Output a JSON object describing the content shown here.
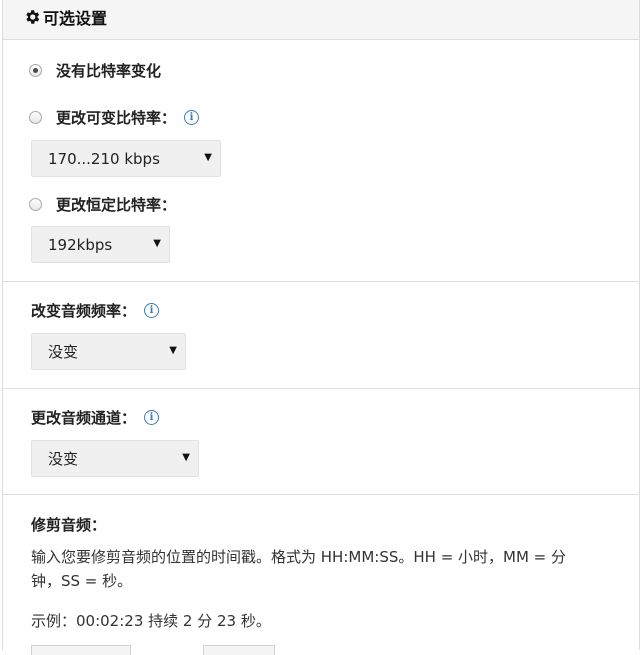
{
  "header": {
    "title": "可选设置",
    "icon": "gear-icon"
  },
  "bitrate": {
    "options": [
      {
        "label": "没有比特率变化",
        "checked": true
      },
      {
        "label": "更改可变比特率：",
        "checked": false
      },
      {
        "label": "更改恒定比特率：",
        "checked": false
      }
    ],
    "variable_select": "170...210 kbps",
    "constant_select": "192kbps"
  },
  "sample_rate": {
    "label": "改变音频频率：",
    "select": "没变"
  },
  "channels": {
    "label": "更改音频通道：",
    "select": "没变"
  },
  "trim": {
    "label": "修剪音频：",
    "desc_line1": "输入您要修剪音频的位置的时间戳。格式为 HH:MM:SS。HH = 小时，MM = 分",
    "desc_line2": "钟，SS = 秒。",
    "example": "示例：00:02:23 持续 2 分 23 秒。"
  },
  "colors": {
    "accent": "#3a7bbf",
    "header_bg": "#f5f5f5",
    "select_bg": "#f0f0f0"
  }
}
